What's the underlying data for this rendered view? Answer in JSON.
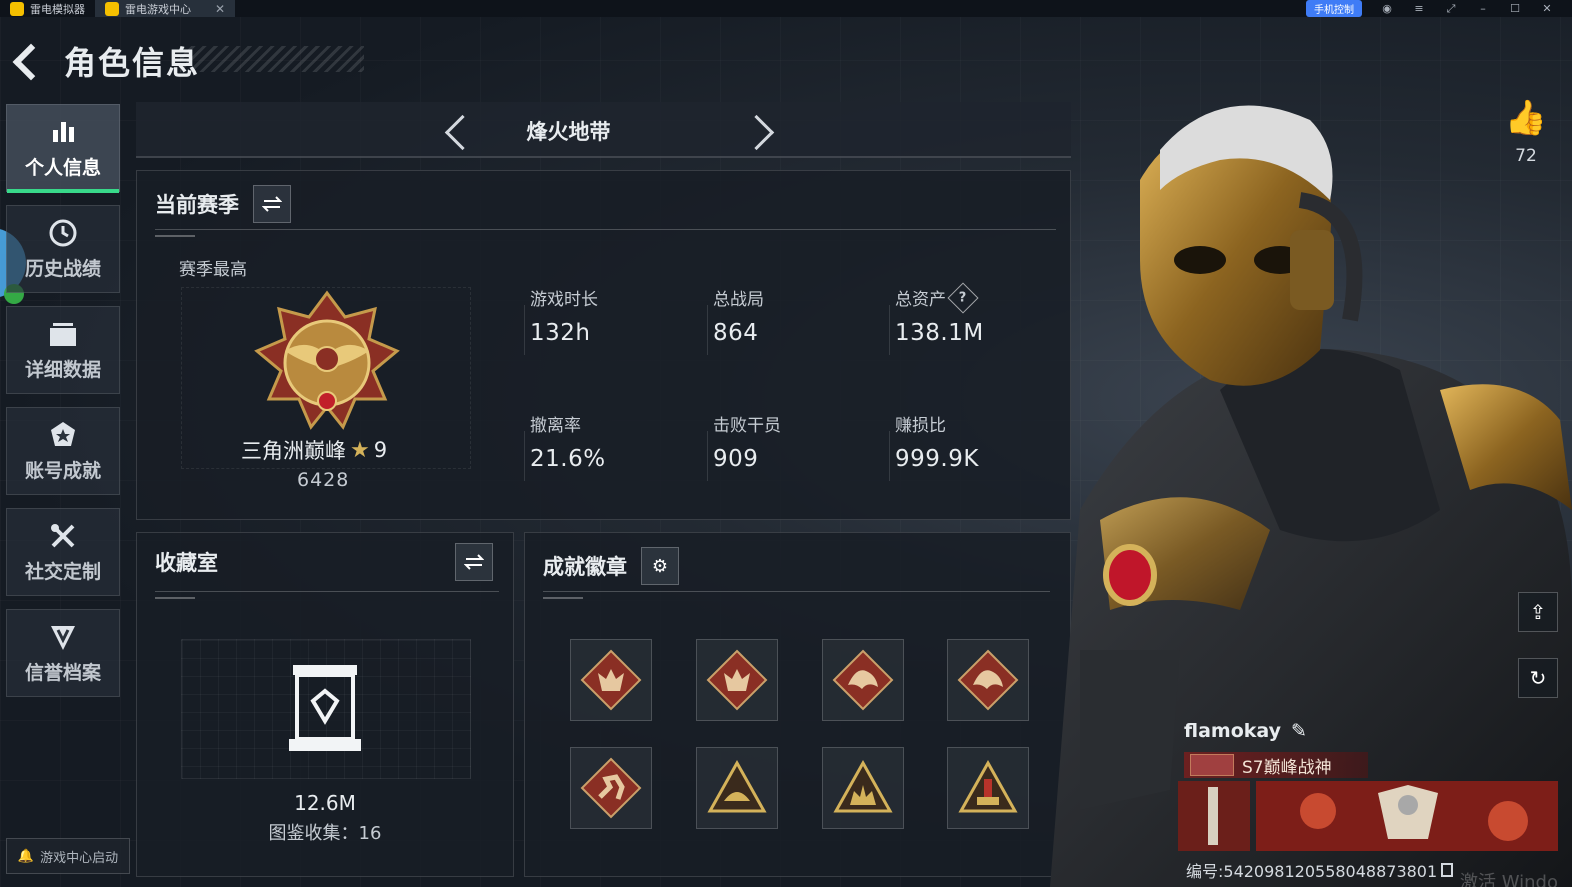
{
  "emulator": {
    "tabs": [
      {
        "label": "雷电模拟器"
      },
      {
        "label": "雷电游戏中心",
        "close": "✕"
      }
    ],
    "controls": {
      "remote_label": "手机控制"
    },
    "watermark": "激活 Windo"
  },
  "header": {
    "title": "角色信息"
  },
  "nav": {
    "items": [
      {
        "label": "个人信息",
        "icon": "bar-chart-icon",
        "active": true
      },
      {
        "label": "历史战绩",
        "icon": "clock-icon"
      },
      {
        "label": "详细数据",
        "icon": "folder-icon"
      },
      {
        "label": "账号成就",
        "icon": "medal-icon"
      },
      {
        "label": "社交定制",
        "icon": "tools-icon"
      },
      {
        "label": "信誉档案",
        "icon": "shield-icon"
      }
    ],
    "launch_label": "游戏中心启动"
  },
  "mode": {
    "name": "烽火地带"
  },
  "season": {
    "title": "当前赛季",
    "peak_label": "赛季最高",
    "rank_name": "三角洲巅峰",
    "rank_stars": "9",
    "rank_score": "6428",
    "stats": [
      {
        "label": "游戏时长",
        "value": "132h"
      },
      {
        "label": "总战局",
        "value": "864"
      },
      {
        "label": "总资产",
        "value": "138.1M",
        "help": "?"
      },
      {
        "label": "撤离率",
        "value": "21.6%"
      },
      {
        "label": "击败干员",
        "value": "909"
      },
      {
        "label": "赚损比",
        "value": "999.9K"
      }
    ]
  },
  "collection": {
    "title": "收藏室",
    "value": "12.6M",
    "count_text": "图鉴收集：16"
  },
  "achievements": {
    "title": "成就徽章",
    "badges": [
      {
        "icon": "wolf-badge-icon"
      },
      {
        "icon": "wolf-badge-icon"
      },
      {
        "icon": "dragon-badge-icon"
      },
      {
        "icon": "dragon-badge-icon"
      },
      {
        "icon": "runner-badge-icon"
      },
      {
        "icon": "helmet-badge-icon"
      },
      {
        "icon": "squad-badge-icon"
      },
      {
        "icon": "tower-badge-icon"
      }
    ]
  },
  "profile": {
    "likes": "72",
    "player_name": "flamokay",
    "title_badge": "S7巅峰战神",
    "uid_text": "编号:542098120558048873801"
  },
  "colors": {
    "accent": "#38d98a",
    "gold": "#d4b25a",
    "badge_red": "#8a2f24"
  }
}
